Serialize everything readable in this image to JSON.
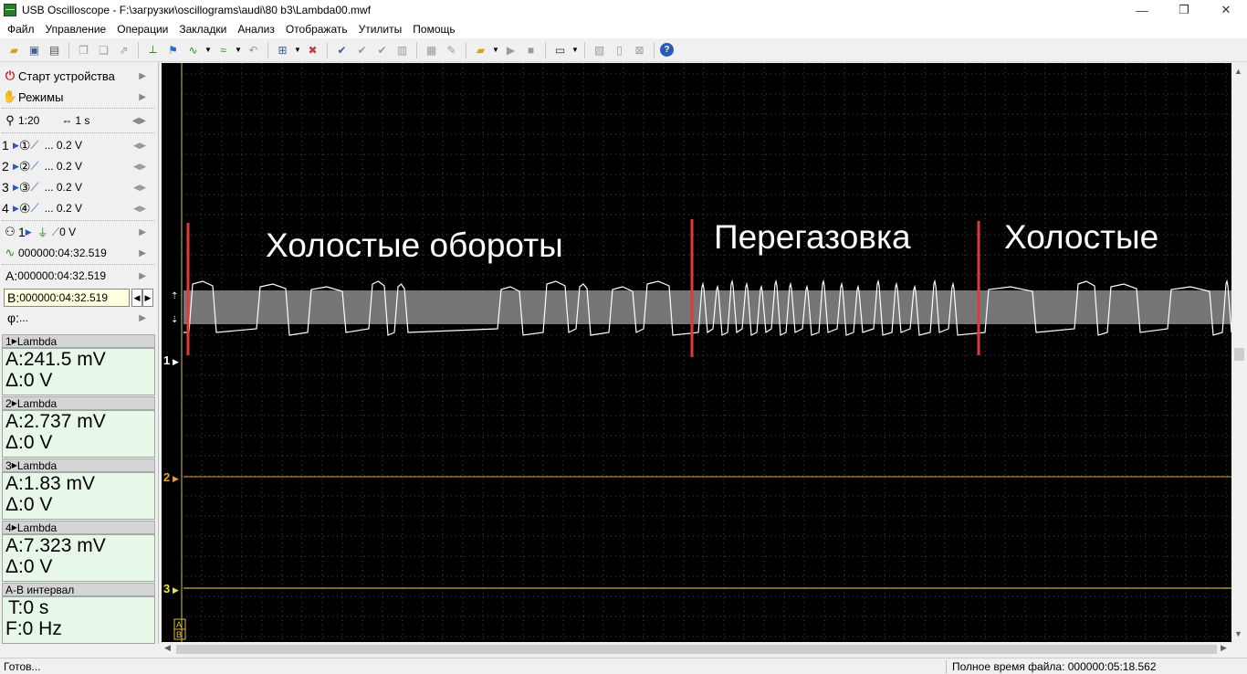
{
  "window": {
    "title": "USB Oscilloscope - F:\\загрузки\\oscillograms\\audi\\80 b3\\Lambda00.mwf",
    "min_glyph": "—",
    "max_glyph": "❐",
    "close_glyph": "✕"
  },
  "menu": [
    "Файл",
    "Управление",
    "Операции",
    "Закладки",
    "Анализ",
    "Отображать",
    "Утилиты",
    "Помощь"
  ],
  "sidebar": {
    "start_label": "Старт устройства",
    "modes_label": "Режимы",
    "zoom": "1:20",
    "timebase": "1 s",
    "channels": [
      {
        "num": "1",
        "circle": "①",
        "value": "... 0.2 V"
      },
      {
        "num": "2",
        "circle": "②",
        "value": "... 0.2 V"
      },
      {
        "num": "3",
        "circle": "③",
        "value": "... 0.2 V"
      },
      {
        "num": "4",
        "circle": "④",
        "value": "... 0.2 V"
      }
    ],
    "trigger_channel": "1",
    "trigger_level": "0 V",
    "trigger_time": "000000:04:32.519",
    "cursor_a": "000000:04:32.519",
    "cursor_b": "000000:04:32.519",
    "phi": "..."
  },
  "measurements": [
    {
      "header": "Lambda",
      "num": "1",
      "a": "A:241.5 mV",
      "d": "Δ:0 V"
    },
    {
      "header": "Lambda",
      "num": "2",
      "a": "A:2.737 mV",
      "d": "Δ:0 V"
    },
    {
      "header": "Lambda",
      "num": "3",
      "a": "A:1.83 mV",
      "d": "Δ:0 V"
    },
    {
      "header": "Lambda",
      "num": "4",
      "a": "A:7.323 mV",
      "d": "Δ:0 V"
    }
  ],
  "ab_interval": {
    "header": "A-B интервал",
    "t": "T:0 s",
    "f": "F:0 Hz"
  },
  "scope": {
    "annotations": [
      "Холостые обороты",
      "Перегазовка",
      "Холостые"
    ],
    "channel_markers": [
      "1",
      "2",
      "3"
    ],
    "ab_marker": [
      "A",
      "B"
    ],
    "colors": {
      "ch1": "#ffffff",
      "ch2": "#e8a030",
      "ch3": "#f0e040",
      "marker": "#e03a3a",
      "grid": "#555555"
    }
  },
  "status": {
    "left": "Готов...",
    "right": "Полное время файла: 000000:05:18.562"
  }
}
